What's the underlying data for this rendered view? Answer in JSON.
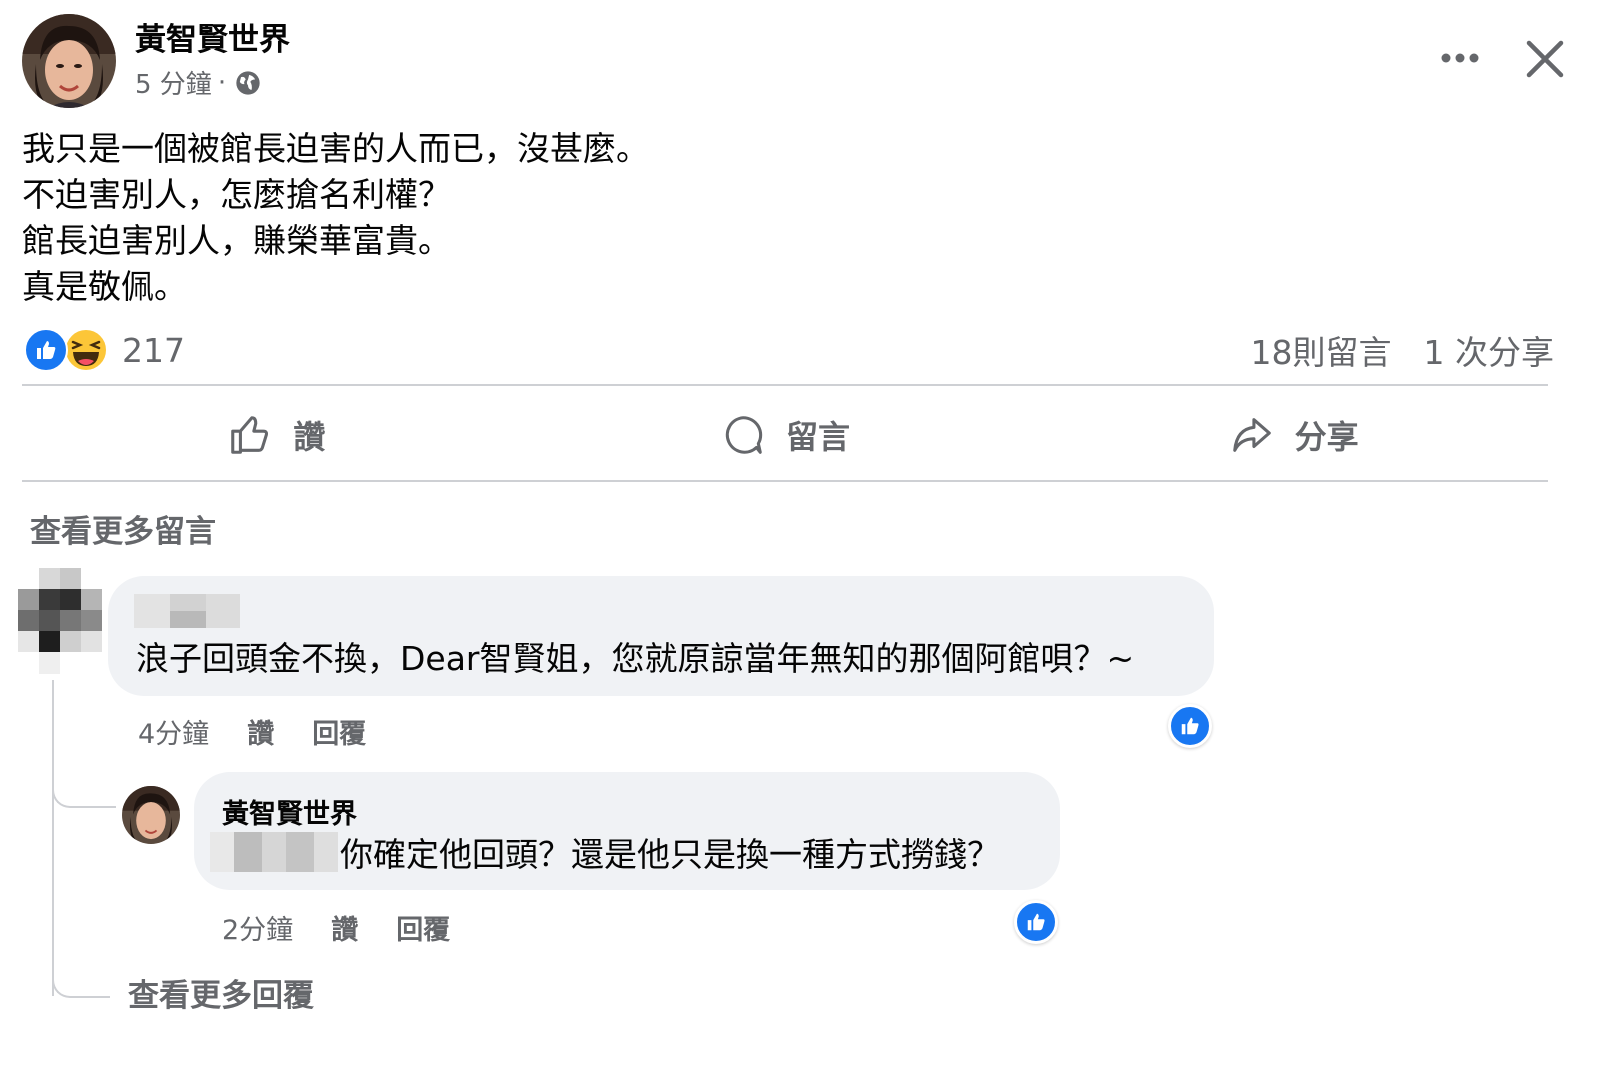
{
  "post": {
    "author": "黃智賢世界",
    "time": "5 分鐘",
    "dot": "·",
    "body_lines": [
      "我只是一個被館長迫害的人而已，沒甚麼。",
      "不迫害別人，怎麼搶名利權？",
      "館長迫害別人，賺榮華富貴。",
      "真是敬佩。"
    ],
    "reaction_count": "217",
    "comments_count": "18則留言",
    "shares_count": "1 次分享",
    "reaction_icons": [
      "like-icon",
      "haha-icon"
    ]
  },
  "actions": {
    "like": "讚",
    "comment": "留言",
    "share": "分享"
  },
  "comments": {
    "view_more": "查看更多留言",
    "first": {
      "text": "浪子回頭金不換，Dear智賢姐，您就原諒當年無知的那個阿館唄？~",
      "time": "4分鐘",
      "like": "讚",
      "reply": "回覆"
    },
    "reply": {
      "author": "黃智賢世界",
      "text": "你確定他回頭？還是他只是換一種方式撈錢？",
      "time": "2分鐘",
      "like": "讚",
      "reply": "回覆"
    },
    "view_more_replies": "查看更多回覆"
  },
  "colors": {
    "brand_blue": "#1877f2",
    "secondary_text": "#65676b",
    "bubble_bg": "#f0f2f5"
  }
}
